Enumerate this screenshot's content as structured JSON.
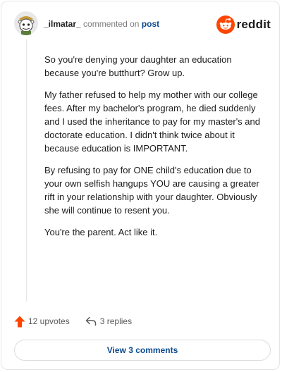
{
  "header": {
    "username": "_ilmatar_",
    "action_text": "commented on",
    "post_link": "post",
    "brand_name": "reddit",
    "avatar_icon": "snoo-avatar-icon",
    "brand_icon": "reddit-logo-icon"
  },
  "comment": {
    "paragraphs": [
      "So you're denying your daughter an education because you're butthurt? Grow up.",
      "My father refused to help my mother with our college fees. After my bachelor's program, he died suddenly and I used the inheritance to pay for my master's and doctorate education. I didn't think twice about it because education is IMPORTANT.",
      "By refusing to pay for ONE child's education due to your own selfish hangups YOU are causing a greater rift in your relationship with your daughter. Obviously she will continue to resent you.",
      "You're the parent. Act like it."
    ]
  },
  "actions": {
    "upvotes": "12 upvotes",
    "replies": "3 replies",
    "upvote_icon": "upvote-arrow-icon",
    "reply_icon": "reply-arrow-icon"
  },
  "footer": {
    "view_comments": "View 3 comments"
  },
  "colors": {
    "brand_orange": "#ff4500",
    "link_blue": "#0a4a8f",
    "muted_text": "#7c7c7c"
  }
}
